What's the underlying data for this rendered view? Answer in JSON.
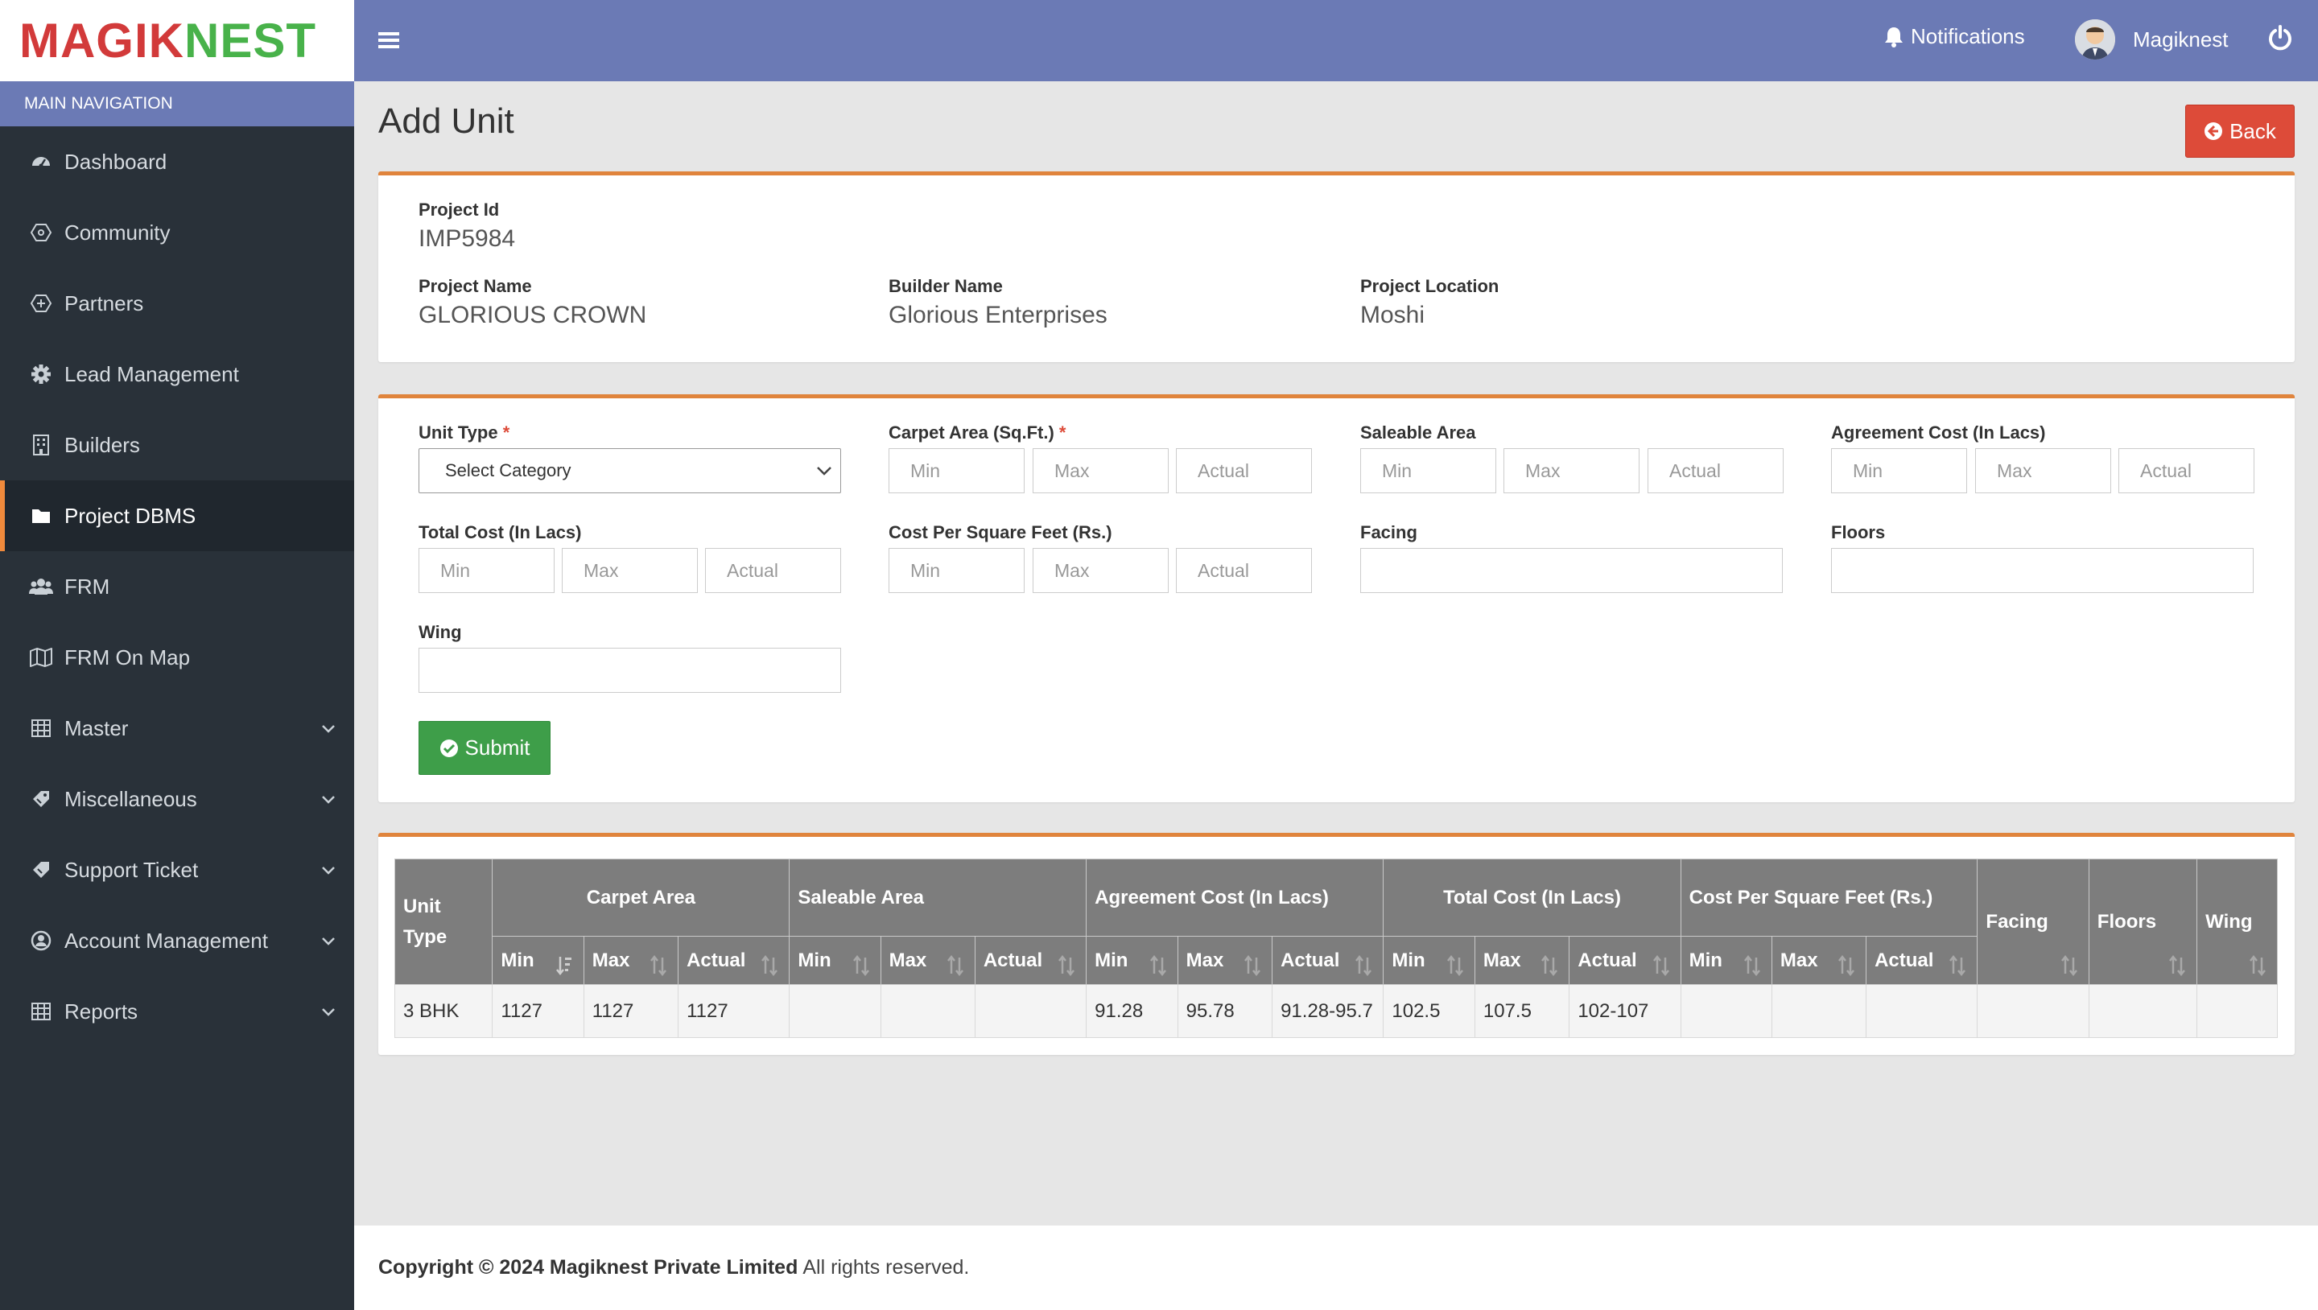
{
  "brand": {
    "logo_part1": "MAGIK",
    "logo_part2": "NEST"
  },
  "sidebar": {
    "header": "MAIN NAVIGATION",
    "items": [
      {
        "label": "Dashboard",
        "icon": "dashboard-icon"
      },
      {
        "label": "Community",
        "icon": "community-icon"
      },
      {
        "label": "Partners",
        "icon": "partners-icon"
      },
      {
        "label": "Lead Management",
        "icon": "gear-icon"
      },
      {
        "label": "Builders",
        "icon": "building-icon"
      },
      {
        "label": "Project DBMS",
        "icon": "folder-icon",
        "active": true
      },
      {
        "label": "FRM",
        "icon": "users-icon"
      },
      {
        "label": "FRM On Map",
        "icon": "map-icon"
      },
      {
        "label": "Master",
        "icon": "table-icon",
        "expandable": true
      },
      {
        "label": "Miscellaneous",
        "icon": "tag-icon",
        "expandable": true
      },
      {
        "label": "Support Ticket",
        "icon": "ticket-icon",
        "expandable": true
      },
      {
        "label": "Account Management",
        "icon": "user-circle-icon",
        "expandable": true
      },
      {
        "label": "Reports",
        "icon": "table-icon",
        "expandable": true
      }
    ]
  },
  "topbar": {
    "notifications_label": "Notifications",
    "user_name": "Magiknest"
  },
  "page": {
    "title": "Add Unit",
    "back_label": "Back"
  },
  "project_info": {
    "project_id_label": "Project Id",
    "project_id": "IMP5984",
    "project_name_label": "Project Name",
    "project_name": "GLORIOUS CROWN",
    "builder_name_label": "Builder Name",
    "builder_name": "Glorious Enterprises",
    "location_label": "Project Location",
    "location": "Moshi"
  },
  "form": {
    "unit_type_label": "Unit Type",
    "unit_type_value": "Select Category",
    "carpet_area_label": "Carpet Area (Sq.Ft.)",
    "saleable_area_label": "Saleable Area",
    "agreement_cost_label": "Agreement Cost (In Lacs)",
    "total_cost_label": "Total Cost (In Lacs)",
    "cost_per_sqft_label": "Cost Per Square Feet (Rs.)",
    "facing_label": "Facing",
    "floors_label": "Floors",
    "wing_label": "Wing",
    "min_placeholder": "Min",
    "max_placeholder": "Max",
    "actual_placeholder": "Actual",
    "required_mark": "*",
    "submit_label": "Submit"
  },
  "table": {
    "unit_type_header": "Unit Type",
    "groups": [
      "Carpet Area",
      "Saleable Area",
      "Agreement Cost (In Lacs)",
      "Total Cost (In Lacs)",
      "Cost Per Square Feet (Rs.)"
    ],
    "sub_headers": [
      "Min",
      "Max",
      "Actual"
    ],
    "single_headers": [
      "Facing",
      "Floors",
      "Wing"
    ],
    "rows": [
      {
        "unit_type": "3 BHK",
        "cells": [
          "1127",
          "1127",
          "1127",
          "",
          "",
          "",
          "91.28",
          "95.78",
          "91.28-95.7",
          "102.5",
          "107.5",
          "102-107",
          "",
          "",
          "",
          "",
          "",
          ""
        ]
      }
    ]
  },
  "footer": {
    "copyright": "Copyright © 2024 Magiknest Private Limited",
    "rights": "All rights reserved."
  }
}
